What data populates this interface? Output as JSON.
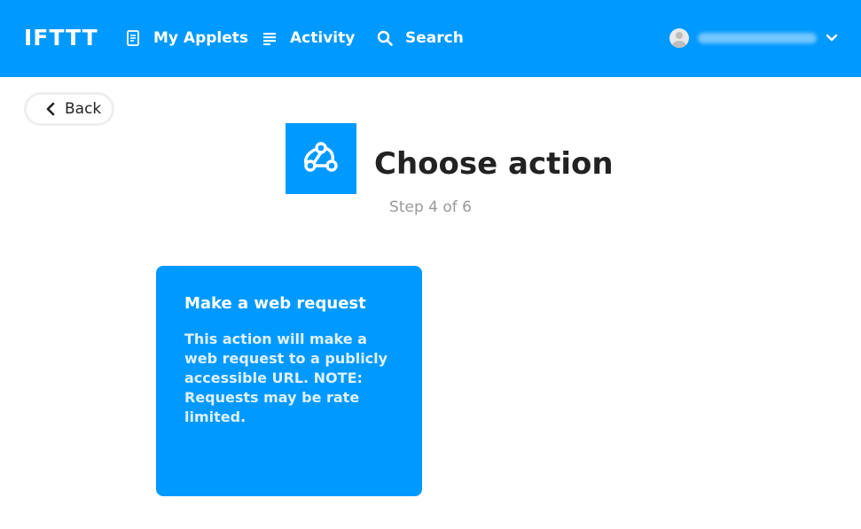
{
  "brand": {
    "logo_text": "IFTTT",
    "accent_color": "#0099ff"
  },
  "nav": {
    "my_applets": {
      "label": "My Applets",
      "icon": "applets-doc-icon"
    },
    "activity": {
      "label": "Activity",
      "icon": "activity-list-icon"
    },
    "search": {
      "label": "Search",
      "icon": "search-icon"
    }
  },
  "account": {
    "avatar_icon": "user-avatar-icon",
    "username_blurred": true,
    "dropdown_icon": "chevron-down-icon"
  },
  "back_button": {
    "label": "Back",
    "icon": "chevron-left-icon"
  },
  "header": {
    "service_icon": "webhooks-icon",
    "title": "Choose action",
    "step": "Step 4 of 6"
  },
  "actions": [
    {
      "title": "Make a web request",
      "description": "This action will make a web request to a publicly accessible URL. NOTE: Requests may be rate limited."
    }
  ]
}
